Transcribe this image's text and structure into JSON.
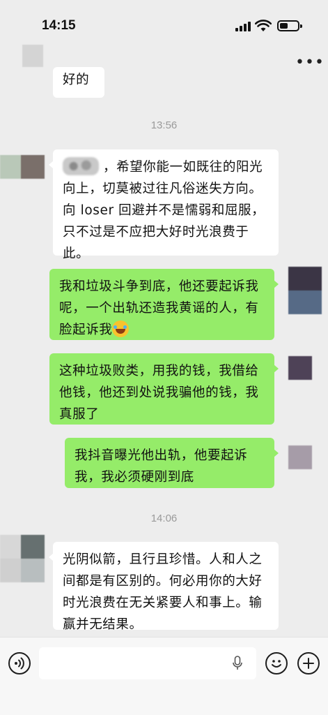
{
  "status_bar": {
    "time": "14:15"
  },
  "header": {
    "more_icon": "more-horizontal-icon"
  },
  "partial_message": {
    "text": "好的"
  },
  "timestamps": [
    "13:56",
    "14:06"
  ],
  "messages": [
    {
      "side": "left",
      "sticker": "blurred-sticker",
      "text": "，希望你能一如既往的阳光向上，切莫被过往凡俗迷失方向。向 loser 回避并不是懦弱和屈服，只不过是不应把大好时光浪费于此。"
    },
    {
      "side": "right",
      "text": "我和垃圾斗争到底，他还要起诉我呢，一个出轨还造我黄谣的人，有脸起诉我",
      "emoji": "rolling-on-floor-laughing-emoji"
    },
    {
      "side": "right",
      "text": "这种垃圾败类，用我的钱，我借给他钱，他还到处说我骗他的钱，我真服了"
    },
    {
      "side": "right",
      "text": "我抖音曝光他出轨，他要起诉我，我必须硬刚到底"
    },
    {
      "side": "left",
      "text": "光阴似箭，且行且珍惜。人和人之间都是有区别的。何必用你的大好时光浪费在无关紧要人和事上。输赢并无结果。"
    }
  ],
  "input_bar": {
    "voice_icon": "voice-mode-icon",
    "input_value": "",
    "mic_icon": "microphone-icon",
    "emoji_icon": "emoji-icon",
    "plus_icon": "plus-icon"
  },
  "colors": {
    "background": "#ededed",
    "bubble_self": "#95ec69",
    "bubble_other": "#ffffff"
  }
}
